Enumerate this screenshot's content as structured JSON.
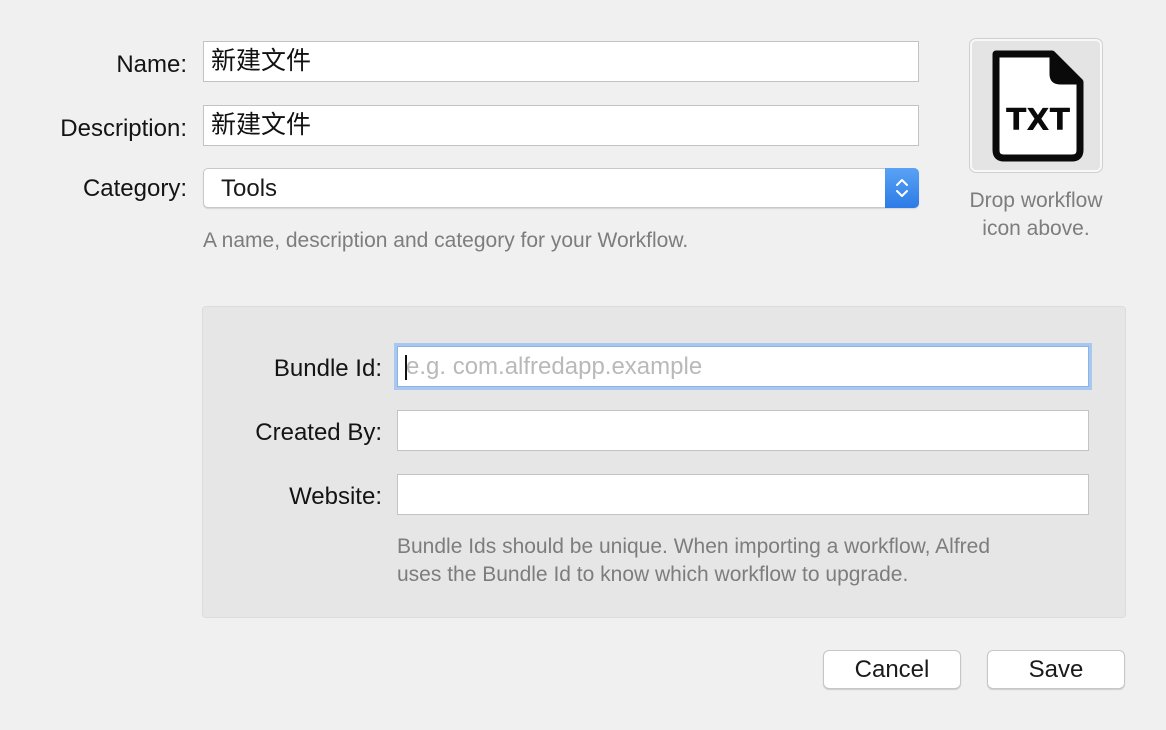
{
  "form": {
    "name_label": "Name:",
    "name_value": "新建文件",
    "description_label": "Description:",
    "description_value": "新建文件",
    "category_label": "Category:",
    "category_value": "Tools",
    "help_text": "A name, description and category for your Workflow."
  },
  "icon_well": {
    "icon_text": "TXT",
    "caption_line1": "Drop workflow",
    "caption_line2": "icon above."
  },
  "bundle_panel": {
    "bundle_id_label": "Bundle Id:",
    "bundle_id_placeholder": "e.g. com.alfredapp.example",
    "created_by_label": "Created By:",
    "created_by_value": "",
    "website_label": "Website:",
    "website_value": "",
    "help_line1": "Bundle Ids should be unique. When importing a workflow, Alfred",
    "help_line2": "uses the Bundle Id to know which workflow to upgrade."
  },
  "buttons": {
    "cancel_label": "Cancel",
    "save_label": "Save"
  },
  "colors": {
    "accent": "#2c7be6",
    "focus_ring": "#a9c8f0",
    "help_text": "#7d7d7d"
  }
}
